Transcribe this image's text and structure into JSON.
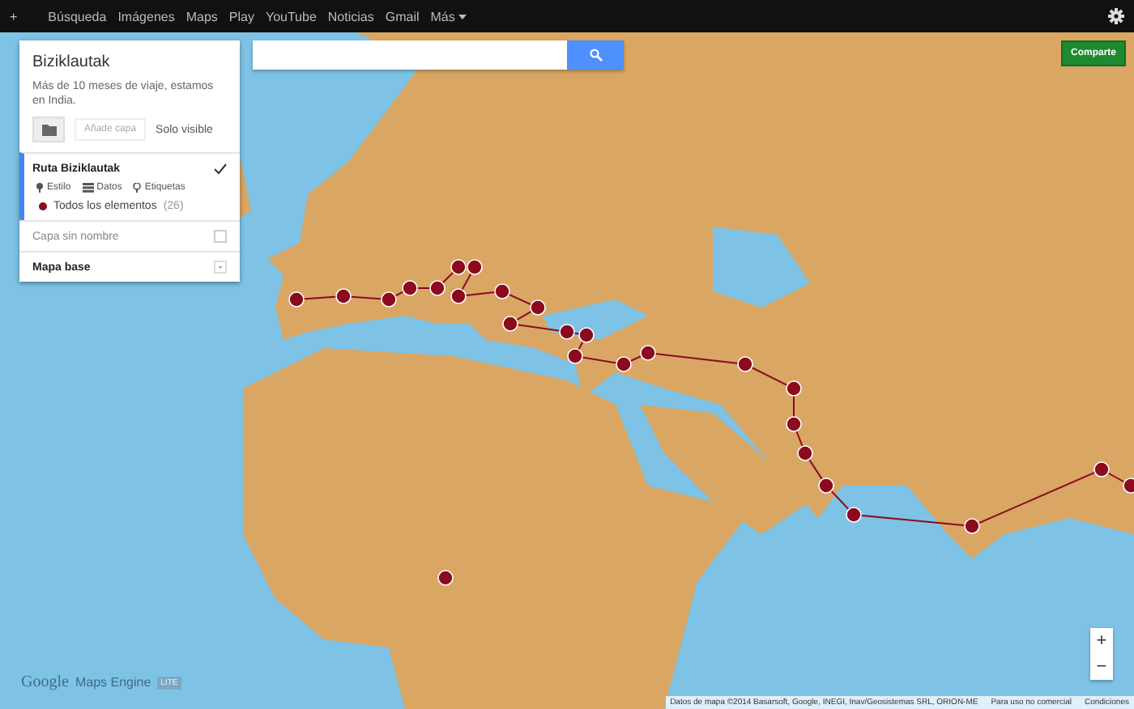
{
  "top_bar": {
    "plus": "+",
    "links": [
      "Búsqueda",
      "Imágenes",
      "Maps",
      "Play",
      "YouTube",
      "Noticias",
      "Gmail"
    ],
    "more": "Más"
  },
  "panel": {
    "title": "Biziklautak",
    "description": "Más de 10 meses de viaje, estamos en India.",
    "add_layer": {
      "label": "Añade capa",
      "disabled": true
    },
    "visible_only": "Solo visible",
    "layers": [
      {
        "name": "Ruta Biziklautak",
        "selected": true,
        "checked": true,
        "tools": [
          "Estilo",
          "Datos",
          "Etiquetas"
        ],
        "legend": {
          "label": "Todos los elementos",
          "count": "(26)",
          "color": "#8b0a1e"
        }
      },
      {
        "name": "Capa sin nombre",
        "selected": false,
        "checked": false
      }
    ],
    "base_map": "Mapa base"
  },
  "share_button": "Comparte",
  "zoom": {
    "in": "+",
    "out": "−"
  },
  "logo": {
    "google": "Google",
    "product": "Maps Engine",
    "badge": "LITE"
  },
  "footer": [
    "Datos de mapa ©2014 Basarsoft, Google, INEGI, Inav/Geosistemas SRL, ORION-ME",
    "Para uso no comercial",
    "Condiciones"
  ]
}
